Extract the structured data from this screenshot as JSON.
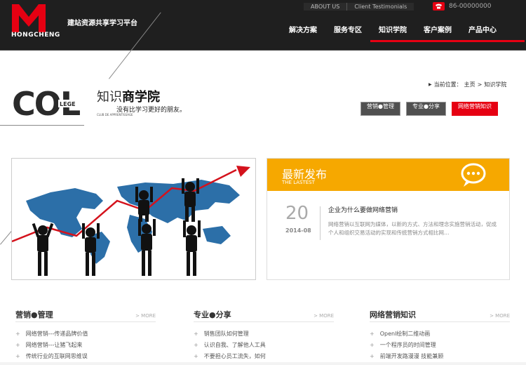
{
  "header": {
    "brand": "HONGCHENG",
    "slogan": "建站资源共享学习平台",
    "top_links": [
      "ABOUT US",
      "Client Testimonials"
    ],
    "phone": "86-00000000",
    "nav": [
      "解决方案",
      "服务专区",
      "知识学院",
      "客户案例",
      "产品中心"
    ],
    "active_nav": "知识学院",
    "brand_color": "#e60012"
  },
  "breadcrumb": {
    "label": "当前位置：",
    "home": "主页",
    "sep": ">",
    "current": "知识学院"
  },
  "page_head": {
    "logo_text": "COL",
    "logo_small": "LEGE",
    "logo_sub": "CLUB DE APPRENTISSAGE",
    "title_plain": "知识",
    "title_bold": "商学院",
    "tagline": "没有比学习更好的朋友。"
  },
  "category_tabs": [
    "营销●管理",
    "专业●分享",
    "网络营销知识"
  ],
  "active_tab": "网络营销知识",
  "latest": {
    "title": "最新发布",
    "subtitle": "THE LASTEST",
    "day": "20",
    "date": "2014-08",
    "headline": "企业为什么要做网络营销",
    "summary": "网络营销以互联网为媒体，以新的方式、方法和理念实施营销活动，促成个人和组织交易活动的实现和传统营销方式相比网…",
    "accent_color": "#f6a800"
  },
  "columns": [
    {
      "name": "营销●管理",
      "more": "> MORE",
      "items": [
        "网络营销---传递品牌价值",
        "网络营销---让猪飞起来",
        "传统行业的互联网思维误"
      ]
    },
    {
      "name": "专业●分享",
      "more": "> MORE",
      "items": [
        "销售团队如何管理",
        "认识自我、了解他人工具",
        "不要担心员工流失，如何"
      ]
    },
    {
      "name": "网络营销知识",
      "more": "> MORE",
      "items": [
        "Openl绘制二维动画",
        "一个程序员的时间管理",
        "前端开发路漫漫 技能兼顾"
      ]
    }
  ],
  "icons": {
    "logo": "hongcheng-logo-icon",
    "phone": "phone-icon",
    "chat": "chat-bubble-icon",
    "arrow": "triangle-right-icon",
    "bullet": "plus-bullet-icon"
  }
}
